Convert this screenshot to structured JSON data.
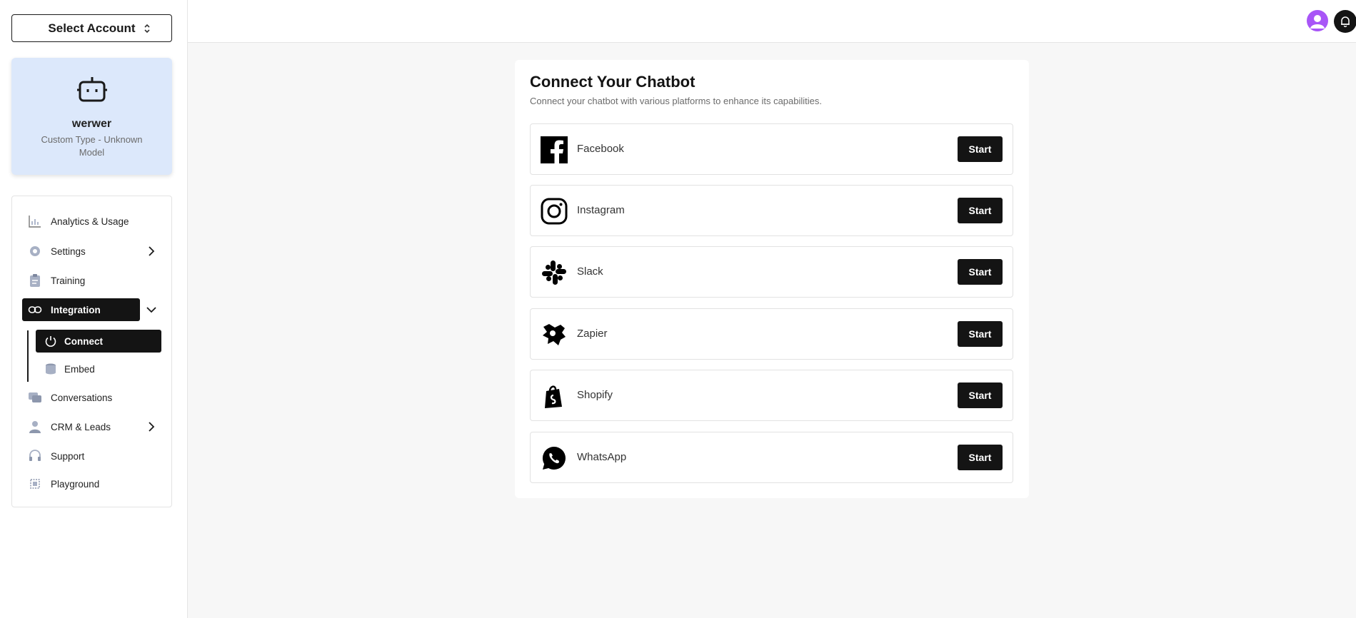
{
  "account_select": {
    "label": "Select Account"
  },
  "bot": {
    "name": "werwer",
    "type": "Custom Type - Unknown Model"
  },
  "nav": {
    "analytics": "Analytics & Usage",
    "settings": "Settings",
    "training": "Training",
    "integration": "Integration",
    "connect": "Connect",
    "embed": "Embed",
    "conversations": "Conversations",
    "crm": "CRM & Leads",
    "support": "Support",
    "playground": "Playground"
  },
  "main": {
    "title": "Connect Your Chatbot",
    "subtitle": "Connect your chatbot with various platforms to enhance its capabilities.",
    "integrations": [
      {
        "name": "Facebook",
        "icon": "facebook-icon",
        "button": "Start"
      },
      {
        "name": "Instagram",
        "icon": "instagram-icon",
        "button": "Start"
      },
      {
        "name": "Slack",
        "icon": "slack-icon",
        "button": "Start"
      },
      {
        "name": "Zapier",
        "icon": "zapier-icon",
        "button": "Start"
      },
      {
        "name": "Shopify",
        "icon": "shopify-icon",
        "button": "Start"
      },
      {
        "name": "WhatsApp",
        "icon": "whatsapp-icon",
        "button": "Start"
      }
    ]
  },
  "colors": {
    "active_bg": "#141414",
    "bot_card_bg": "#dce8fb",
    "avatar": "#a855f7",
    "page_bg": "#f7f7f7"
  }
}
